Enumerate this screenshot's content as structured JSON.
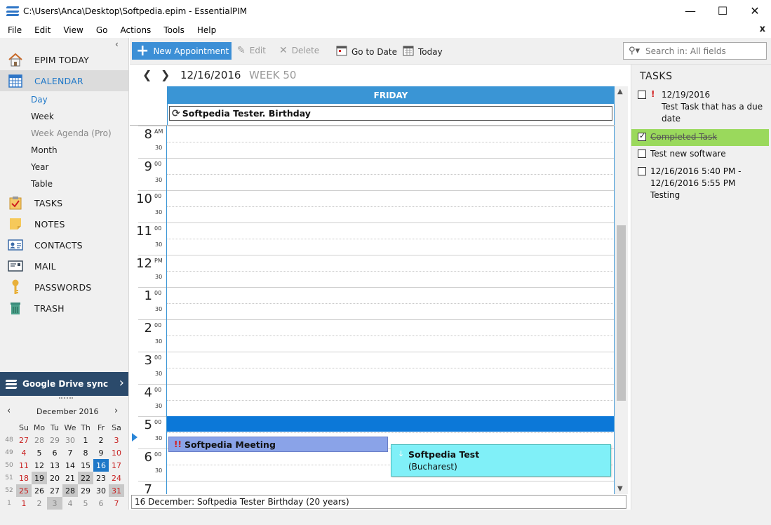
{
  "window": {
    "title": "C:\\Users\\Anca\\Desktop\\Softpedia.epim - EssentialPIM",
    "minimize": "—",
    "maximize": "☐",
    "close": "✕"
  },
  "menu": [
    "File",
    "Edit",
    "View",
    "Go",
    "Actions",
    "Tools",
    "Help"
  ],
  "menu_close": "x",
  "sidebar": {
    "collapse": "‹",
    "modules": [
      {
        "label": "EPIM TODAY",
        "icon": "home-icon"
      },
      {
        "label": "CALENDAR",
        "icon": "calendar-icon",
        "active": true
      },
      {
        "label": "TASKS",
        "icon": "clipboard-check-icon"
      },
      {
        "label": "NOTES",
        "icon": "sticky-note-icon"
      },
      {
        "label": "CONTACTS",
        "icon": "contact-card-icon"
      },
      {
        "label": "MAIL",
        "icon": "envelope-icon"
      },
      {
        "label": "PASSWORDS",
        "icon": "key-icon"
      },
      {
        "label": "TRASH",
        "icon": "trash-icon"
      }
    ],
    "calendar_views": [
      "Day",
      "Week",
      "Week Agenda (Pro)",
      "Month",
      "Year",
      "Table"
    ],
    "sync": {
      "label": "Google Drive sync",
      "arrow": "›"
    }
  },
  "minical": {
    "title": "December  2016",
    "prev": "‹",
    "next": "›",
    "weekdays": [
      "Su",
      "Mo",
      "Tu",
      "We",
      "Th",
      "Fr",
      "Sa"
    ],
    "weeks": [
      {
        "wk": "48",
        "days": [
          "27",
          "28",
          "29",
          "30",
          "1",
          "2",
          "3"
        ]
      },
      {
        "wk": "49",
        "days": [
          "4",
          "5",
          "6",
          "7",
          "8",
          "9",
          "10"
        ]
      },
      {
        "wk": "50",
        "days": [
          "11",
          "12",
          "13",
          "14",
          "15",
          "16",
          "17"
        ]
      },
      {
        "wk": "51",
        "days": [
          "18",
          "19",
          "20",
          "21",
          "22",
          "23",
          "24"
        ]
      },
      {
        "wk": "52",
        "days": [
          "25",
          "26",
          "27",
          "28",
          "29",
          "30",
          "31"
        ]
      },
      {
        "wk": "1",
        "days": [
          "1",
          "2",
          "3",
          "4",
          "5",
          "6",
          "7"
        ]
      }
    ]
  },
  "toolbar": {
    "new_appointment": "New Appointment",
    "edit": "Edit",
    "delete": "Delete",
    "go_to_date": "Go to Date",
    "today": "Today",
    "search_placeholder": "Search in: All fields"
  },
  "calendar": {
    "date": "12/16/2016",
    "week": "WEEK 50",
    "day_name": "FRIDAY",
    "allday_event": "Softpedia Tester. Birthday",
    "hours": [
      {
        "num": "8",
        "suffix": "AM"
      },
      {
        "num": "9",
        "suffix": "00"
      },
      {
        "num": "10",
        "suffix": "00"
      },
      {
        "num": "11",
        "suffix": "00"
      },
      {
        "num": "12",
        "suffix": "PM"
      },
      {
        "num": "1",
        "suffix": "00"
      },
      {
        "num": "2",
        "suffix": "00"
      },
      {
        "num": "3",
        "suffix": "00"
      },
      {
        "num": "4",
        "suffix": "00"
      },
      {
        "num": "5",
        "suffix": "00"
      },
      {
        "num": "6",
        "suffix": "00"
      },
      {
        "num": "7",
        "suffix": ""
      }
    ],
    "half_label": "30",
    "events": {
      "meeting": {
        "priority": "!!",
        "title": "Softpedia Meeting"
      },
      "test": {
        "title": "Softpedia Test",
        "location": "(Bucharest)"
      }
    },
    "status": "16 December:  Softpedia Tester Birthday  (20 years)"
  },
  "tasks": {
    "title": "TASKS",
    "items": [
      {
        "text": "12/19/2016\nTest Task that has a due date",
        "priority": "!",
        "done": false
      },
      {
        "text": "Completed Task",
        "done": true
      },
      {
        "text": "Test new software",
        "done": false
      },
      {
        "text": "12/16/2016 5:40 PM -\n12/16/2016 5:55 PM\nTesting",
        "done": false
      }
    ]
  }
}
